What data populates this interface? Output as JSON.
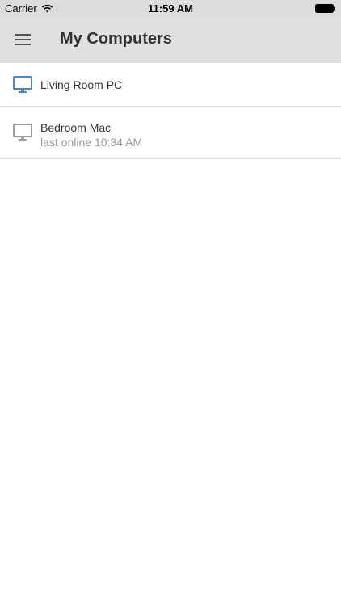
{
  "status_bar": {
    "carrier": "Carrier",
    "time": "11:59 AM",
    "wifi_icon": "wifi-icon",
    "battery_icon": "battery-icon"
  },
  "app_bar": {
    "menu_icon": "menu-icon",
    "title": "My Computers"
  },
  "colors": {
    "online_icon": "#4a86d6",
    "offline_icon": "#9e9e9e",
    "app_bar_bg": "#e0e0e0",
    "status_text": "#9a9a9a"
  },
  "computers": [
    {
      "name": "Living Room PC",
      "status": "",
      "online": true,
      "icon": "monitor-icon"
    },
    {
      "name": "Bedroom Mac",
      "status": "last online 10:34 AM",
      "online": false,
      "icon": "monitor-icon"
    }
  ]
}
